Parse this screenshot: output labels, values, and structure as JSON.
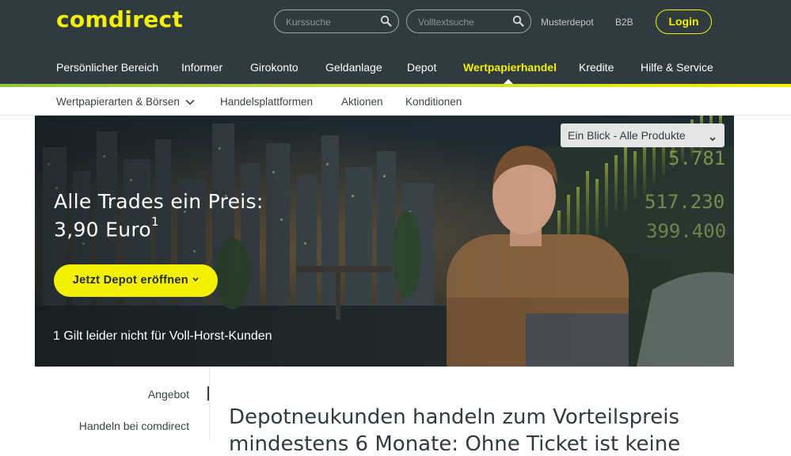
{
  "header": {
    "logo": "comdirect",
    "search_quote_placeholder": "Kurssuche",
    "search_fulltext_placeholder": "Volltextsuche",
    "links": [
      "Musterdepot",
      "B2B"
    ],
    "login_label": "Login"
  },
  "main_nav": [
    {
      "label": "Persönlicher Bereich",
      "active": false
    },
    {
      "label": "Informer",
      "active": false
    },
    {
      "label": "Girokonto",
      "active": false
    },
    {
      "label": "Geldanlage",
      "active": false
    },
    {
      "label": "Depot",
      "active": false
    },
    {
      "label": "Wertpapierhandel",
      "active": true
    },
    {
      "label": "Kredite",
      "active": false
    },
    {
      "label": "Hilfe & Service",
      "active": false
    }
  ],
  "sub_nav": [
    {
      "label": "Wertpapierarten & Börsen",
      "has_dropdown": true
    },
    {
      "label": "Handelsplattformen",
      "has_dropdown": false
    },
    {
      "label": "Aktionen",
      "has_dropdown": false
    },
    {
      "label": "Konditionen",
      "has_dropdown": false
    }
  ],
  "hero": {
    "headline_line1": "Alle Trades ein Preis:",
    "headline_line2": "3,90 Euro",
    "headline_sup": "1",
    "cta_label": "Jetzt Depot eröffnen",
    "footnote": "1 Gilt leider nicht für Voll-Horst-Kunden",
    "product_select": "Ein Blick - Alle Produkte",
    "ticker_numbers": [
      "5.781",
      "517.230",
      "399.400"
    ]
  },
  "sidebar": {
    "items": [
      "Angebot",
      "Handeln bei comdirect"
    ],
    "active_index": 0
  },
  "content": {
    "heading_line1": "Depotneukunden handeln zum Vorteilspreis",
    "heading_line2": "mindestens 6 Monate: Ohne Ticket ist keine"
  },
  "colors": {
    "header_bg": "#2f3b3e",
    "brand_yellow": "#f5f000",
    "text_dark": "#3a4346"
  }
}
